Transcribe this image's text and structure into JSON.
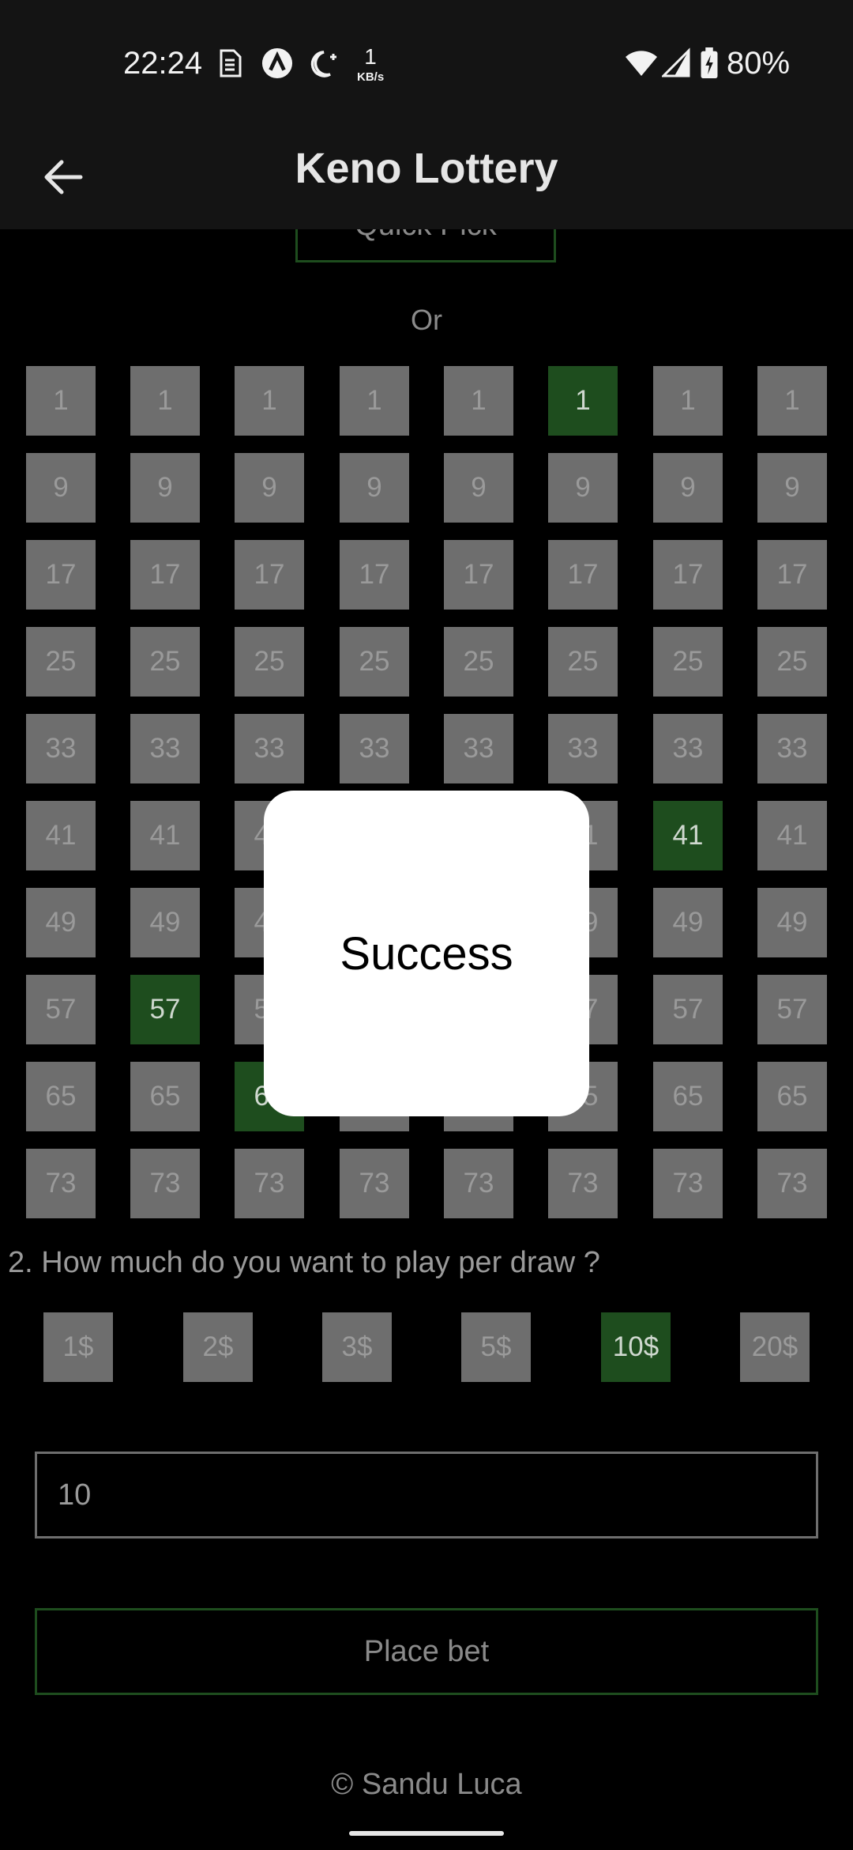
{
  "status_bar": {
    "time": "22:24",
    "speed_value": "1",
    "speed_unit": "KB/s",
    "battery": "80%"
  },
  "app_bar": {
    "title": "Keno Lottery",
    "back_icon": "arrow-left-icon"
  },
  "quick_pick": {
    "label": "Quick Pick"
  },
  "or_label": "Or",
  "grid": {
    "rows": [
      {
        "label": "1",
        "selected_columns": [
          5
        ]
      },
      {
        "label": "9",
        "selected_columns": []
      },
      {
        "label": "17",
        "selected_columns": []
      },
      {
        "label": "25",
        "selected_columns": []
      },
      {
        "label": "33",
        "selected_columns": []
      },
      {
        "label": "41",
        "selected_columns": [
          6
        ]
      },
      {
        "label": "49",
        "selected_columns": []
      },
      {
        "label": "57",
        "selected_columns": [
          1
        ]
      },
      {
        "label": "65",
        "selected_columns": [
          2
        ]
      },
      {
        "label": "73",
        "selected_columns": []
      }
    ],
    "columns": 8
  },
  "question": "2. How much do you want to play per draw ?",
  "amount_options": [
    {
      "label": "1$",
      "selected": false
    },
    {
      "label": "2$",
      "selected": false
    },
    {
      "label": "3$",
      "selected": false
    },
    {
      "label": "5$",
      "selected": false
    },
    {
      "label": "10$",
      "selected": true
    },
    {
      "label": "20$",
      "selected": false
    }
  ],
  "amount_input": {
    "value": "10"
  },
  "place_bet": {
    "label": "Place bet"
  },
  "footer": "© Sandu Luca",
  "dialog": {
    "message": "Success"
  },
  "colors": {
    "selected_green": "#1e4d1e",
    "cell_grey": "#6e6e6e",
    "background": "#000000",
    "bar": "#141414"
  }
}
